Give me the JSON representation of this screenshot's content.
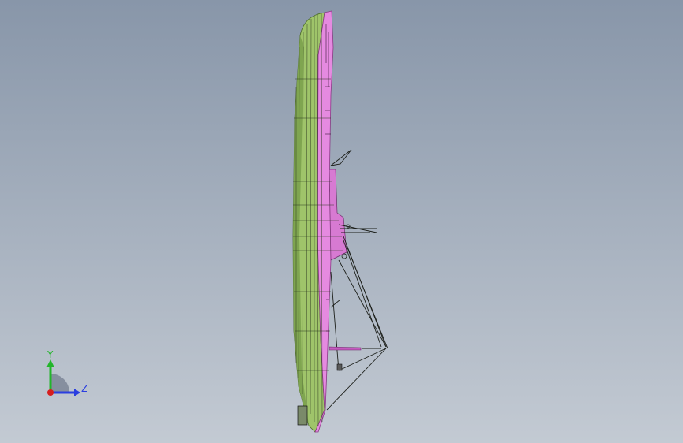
{
  "viewport": {
    "background_top": "#8896a9",
    "background_bottom": "#c3cad3"
  },
  "model": {
    "hull_green": "#9fc46a",
    "hull_green_dark": "#6f9a3f",
    "deck_magenta": "#e58ae0",
    "deck_magenta_dark": "#b84fb3",
    "wire_color": "#1c1f1a"
  },
  "triad": {
    "y_label": "Y",
    "z_label": "Z",
    "y_color": "#22b52a",
    "z_color": "#2a3ee0",
    "x_color": "#d61e1e",
    "quadrant_color": "#7c8696"
  }
}
